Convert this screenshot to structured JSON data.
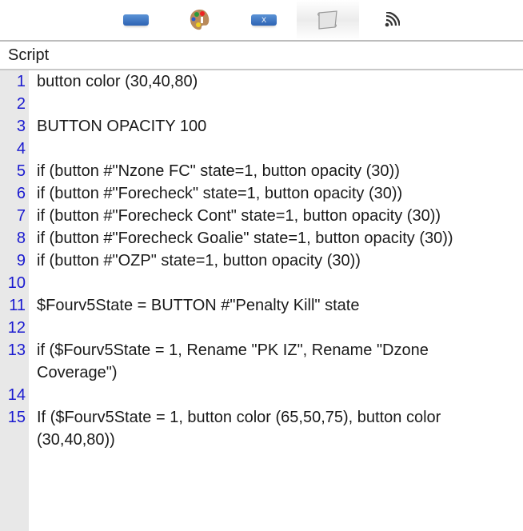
{
  "toolbar": {
    "icons": [
      "button-icon",
      "palette-icon",
      "button-x-icon",
      "script-scroll-icon",
      "rss-feed-icon"
    ],
    "button_x_glyph": "X",
    "active": "script-scroll-icon"
  },
  "panel": {
    "title": "Script"
  },
  "lines": [
    {
      "n": "1",
      "text": "button color (30,40,80)"
    },
    {
      "n": "2",
      "text": ""
    },
    {
      "n": "3",
      "text": "BUTTON OPACITY 100"
    },
    {
      "n": "4",
      "text": ""
    },
    {
      "n": "5",
      "text": "if (button #\"Nzone FC\" state=1, button opacity (30))"
    },
    {
      "n": "6",
      "text": "if (button #\"Forecheck\" state=1, button opacity (30))"
    },
    {
      "n": "7",
      "text": "if (button #\"Forecheck Cont\" state=1, button opacity (30))"
    },
    {
      "n": "8",
      "text": "if (button #\"Forecheck Goalie\" state=1, button opacity (30))"
    },
    {
      "n": "9",
      "text": "if (button #\"OZP\" state=1, button opacity (30))"
    },
    {
      "n": "10",
      "text": ""
    },
    {
      "n": "11",
      "text": "$Fourv5State = BUTTON #\"Penalty Kill\" state"
    },
    {
      "n": "12",
      "text": ""
    },
    {
      "n": "13",
      "text": "if ($Fourv5State = 1, Rename \"PK IZ\", Rename \"Dzone Coverage\")"
    },
    {
      "n": "14",
      "text": ""
    },
    {
      "n": "15",
      "text": "If ($Fourv5State = 1, button color (65,50,75), button color (30,40,80))"
    }
  ]
}
